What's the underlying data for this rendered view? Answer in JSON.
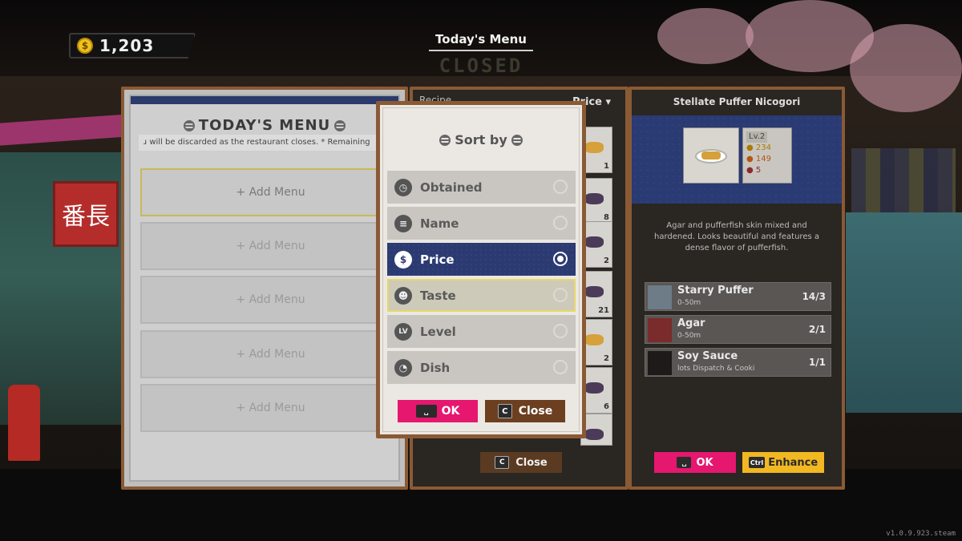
{
  "hud": {
    "coins": "1,203",
    "coin_symbol": "$",
    "title": "Today's Menu",
    "status": "CLOSED"
  },
  "left_panel": {
    "title": "TODAY'S MENU",
    "note": "ɹ will be discarded as the restaurant closes.   * Remaining",
    "slots": [
      "+ Add Menu",
      "+ Add Menu",
      "+ Add Menu",
      "+ Add Menu",
      "+ Add Menu"
    ]
  },
  "mid_panel": {
    "header_left": "Recipe",
    "sort_label": "Price ▾",
    "item_counts": [
      "1",
      "8",
      "2",
      "21",
      "2",
      "6",
      ""
    ],
    "close_key": "C",
    "close_label": "Close"
  },
  "right_panel": {
    "dish_name": "Stellate Puffer Nicogori",
    "level": "Lv.2",
    "price": "234",
    "stat2": "149",
    "stat3": "5",
    "description": "Agar and pufferfish skin mixed and hardened. Looks beautiful and features a dense flavor of pufferfish.",
    "ingredients": [
      {
        "name": "Starry Puffer",
        "location": "0-50m",
        "qty": "14/3"
      },
      {
        "name": "Agar",
        "location": "0-50m",
        "qty": "2/1"
      },
      {
        "name": "Soy Sauce",
        "location": "lots   Dispatch & Cooki",
        "qty": "1/1"
      }
    ],
    "ok_label": "OK",
    "enhance_key": "Ctrl",
    "enhance_label": "Enhance"
  },
  "sort_modal": {
    "title": "Sort by",
    "options": [
      {
        "label": "Obtained",
        "icon": "clock-icon",
        "glyph": "◷"
      },
      {
        "label": "Name",
        "icon": "list-icon",
        "glyph": "≡"
      },
      {
        "label": "Price",
        "icon": "coin-icon",
        "glyph": "$"
      },
      {
        "label": "Taste",
        "icon": "face-icon",
        "glyph": "☻"
      },
      {
        "label": "Level",
        "icon": "level-icon",
        "glyph": "LV"
      },
      {
        "label": "Dish",
        "icon": "dish-icon",
        "glyph": "◔"
      }
    ],
    "selected": "Price",
    "hovered": "Taste",
    "ok_key": "␣",
    "ok_label": "OK",
    "close_key": "C",
    "close_label": "Close"
  },
  "version": "v1.0.9.923.steam",
  "colors": {
    "frame": "#8a5a34",
    "selected": "#2c3a72",
    "ok": "#e5176f",
    "close": "#6b3f1f",
    "enhance": "#f2b822",
    "highlight": "#e6d86a"
  }
}
